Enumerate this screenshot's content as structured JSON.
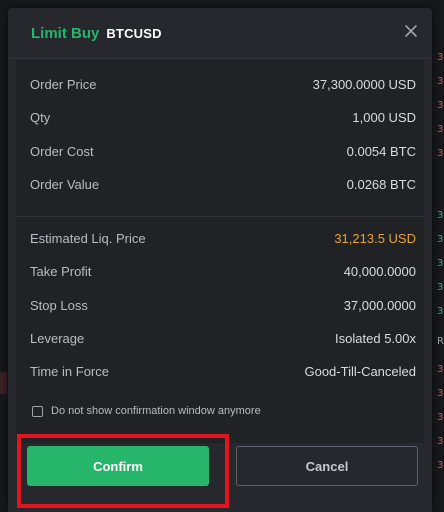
{
  "dialog": {
    "order_type": "Limit Buy",
    "symbol": "BTCUSD"
  },
  "order_details": [
    {
      "label": "Order Price",
      "value": "37,300.0000 USD"
    },
    {
      "label": "Qty",
      "value": "1,000 USD"
    },
    {
      "label": "Order Cost",
      "value": "0.0054 BTC"
    },
    {
      "label": "Order Value",
      "value": "0.0268 BTC"
    }
  ],
  "risk_details": [
    {
      "label": "Estimated Liq. Price",
      "value": "31,213.5 USD",
      "color": "#e8a33c"
    },
    {
      "label": "Take Profit",
      "value": "40,000.0000"
    },
    {
      "label": "Stop Loss",
      "value": "37,000.0000"
    },
    {
      "label": "Leverage",
      "value": "Isolated 5.00x"
    },
    {
      "label": "Time in Force",
      "value": "Good-Till-Canceled"
    }
  ],
  "checkbox": {
    "label": "Do not show confirmation window anymore",
    "checked": false
  },
  "buttons": {
    "confirm": "Confirm",
    "cancel": "Cancel"
  },
  "background": {
    "right_edge_ticks": [
      "3",
      "3",
      "3",
      "3",
      "3",
      "3",
      "3",
      "3",
      "3",
      "3",
      "R",
      "3",
      "3",
      "3",
      "3",
      "3"
    ]
  }
}
